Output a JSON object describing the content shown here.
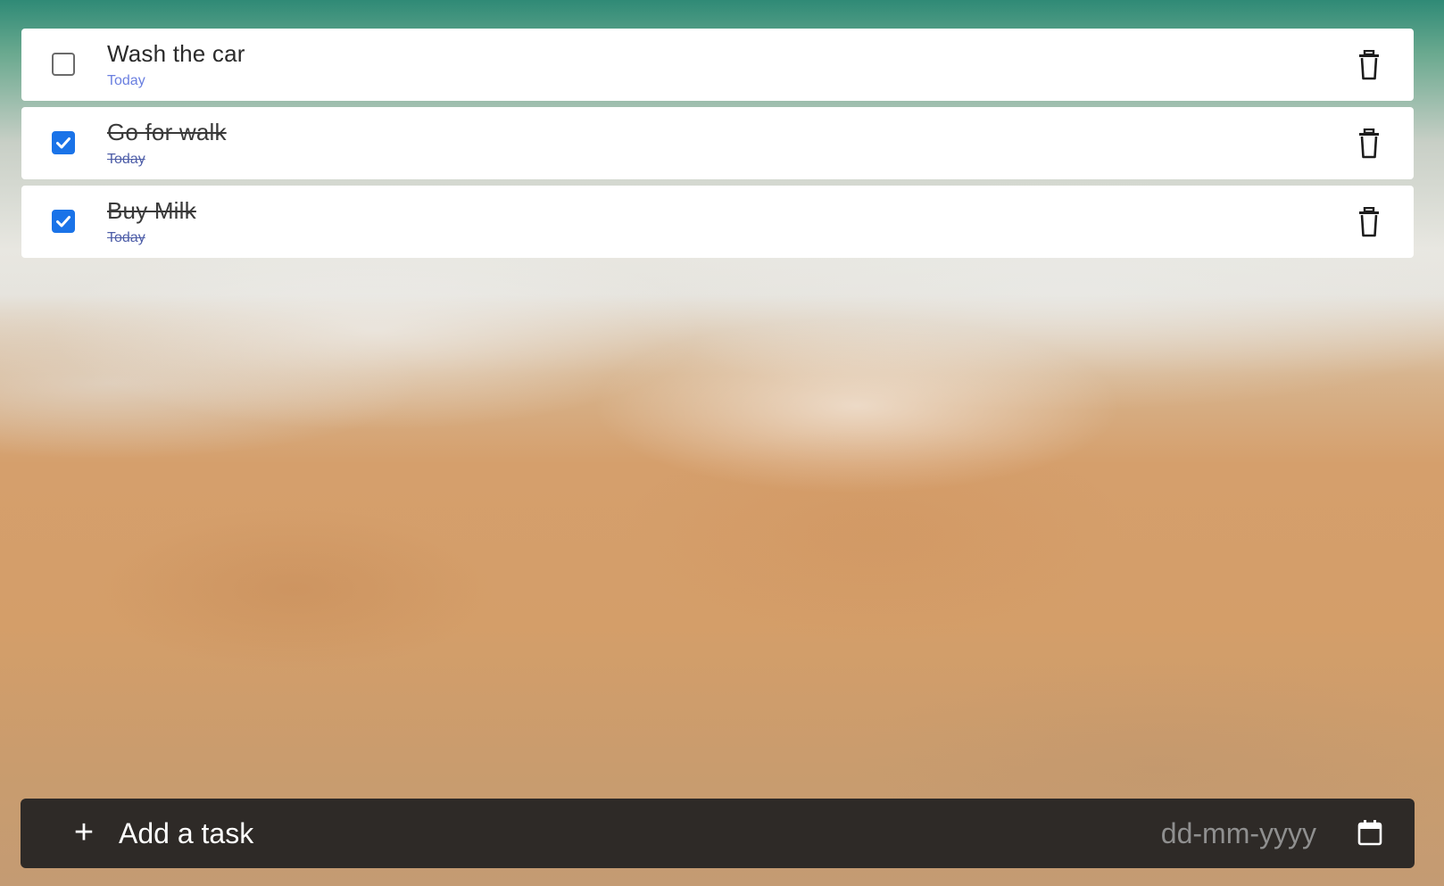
{
  "tasks": [
    {
      "title": "Wash the car",
      "due": "Today",
      "completed": false
    },
    {
      "title": "Go for walk",
      "due": "Today",
      "completed": true
    },
    {
      "title": "Buy Milk",
      "due": "Today",
      "completed": true
    }
  ],
  "add_bar": {
    "plus_icon": "plus-icon",
    "input_placeholder": "Add a task",
    "input_value": "",
    "date_placeholder": "dd-mm-yyyy",
    "calendar_icon": "calendar-icon"
  },
  "icons": {
    "delete": "trash-icon",
    "check": "checkmark-icon"
  },
  "colors": {
    "checkbox_checked": "#1a73e8",
    "due_today": "#6a7fe0",
    "add_bar_bg": "#2e2a27"
  }
}
